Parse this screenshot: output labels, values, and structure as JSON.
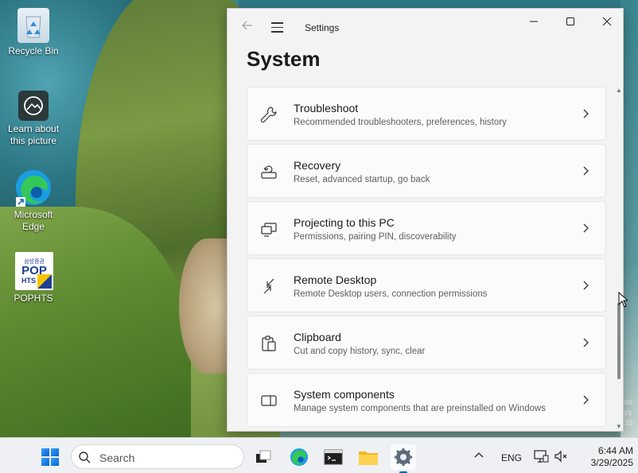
{
  "desktop": {
    "icons": [
      {
        "label": "Recycle Bin"
      },
      {
        "label": "Learn about this picture"
      },
      {
        "label": "Microsoft Edge"
      },
      {
        "label": "POPHTS"
      }
    ],
    "pophts_logo_text_1": "삼성증권",
    "pophts_logo_text_2": "POP",
    "pophts_logo_text_3": "HTS",
    "watermark_lines": [
      "on",
      "ys",
      "35"
    ]
  },
  "window": {
    "title": "Settings",
    "page_title": "System",
    "items": [
      {
        "title": "Troubleshoot",
        "subtitle": "Recommended troubleshooters, preferences, history",
        "icon": "wrench-icon"
      },
      {
        "title": "Recovery",
        "subtitle": "Reset, advanced startup, go back",
        "icon": "recovery-icon"
      },
      {
        "title": "Projecting to this PC",
        "subtitle": "Permissions, pairing PIN, discoverability",
        "icon": "projecting-icon"
      },
      {
        "title": "Remote Desktop",
        "subtitle": "Remote Desktop users, connection permissions",
        "icon": "remote-desktop-icon"
      },
      {
        "title": "Clipboard",
        "subtitle": "Cut and copy history, sync, clear",
        "icon": "clipboard-icon"
      },
      {
        "title": "System components",
        "subtitle": "Manage system components that are preinstalled on Windows",
        "icon": "system-components-icon"
      }
    ]
  },
  "taskbar": {
    "search_placeholder": "Search",
    "language": "ENG",
    "time": "6:44 AM",
    "date": "3/29/2025",
    "apps": [
      "task-view",
      "microsoft-edge",
      "terminal",
      "file-explorer",
      "settings"
    ],
    "accent": "#0067c0"
  }
}
